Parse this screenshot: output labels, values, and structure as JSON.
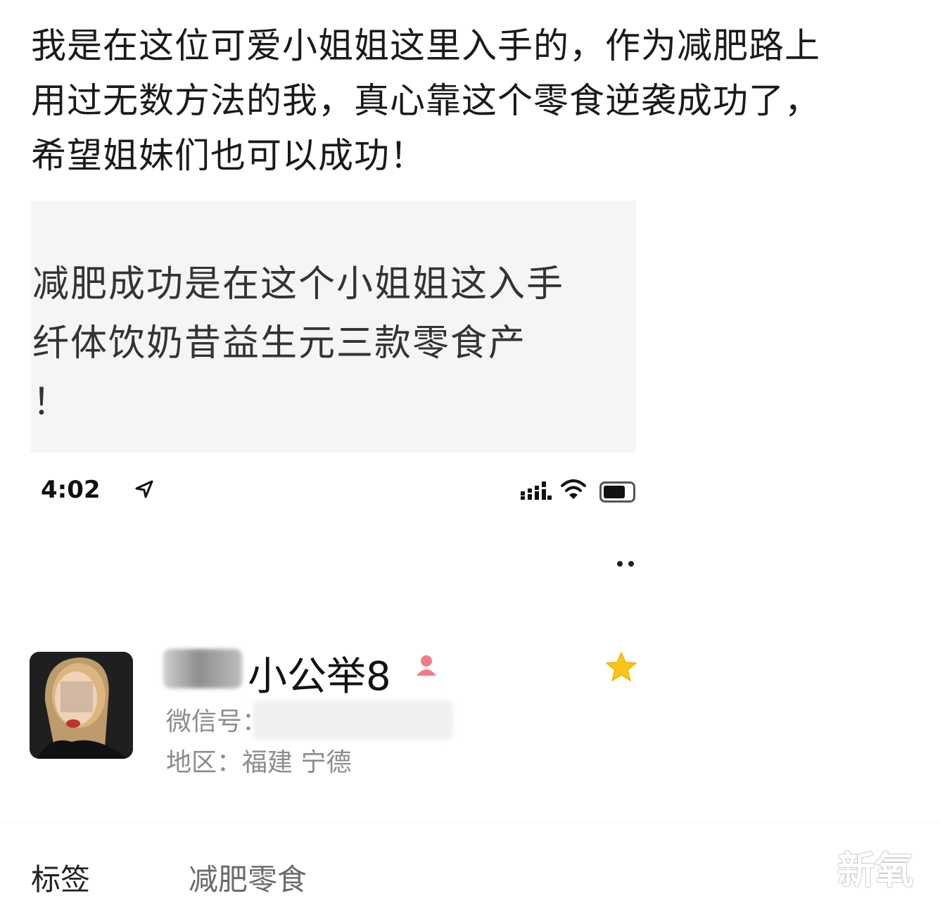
{
  "post": {
    "lines": [
      "我是在这位可爱小姐姐这里入手的，作为减肥路上",
      "用过无数方法的我，真心靠这个零食逆袭成功了，",
      "希望姐妹们也可以成功！"
    ]
  },
  "quote": {
    "lines": [
      "减肥成功是在这个小姐姐这入手",
      "纤体饮奶昔益生元三款零食产",
      "！"
    ]
  },
  "status_bar": {
    "time": "4:02"
  },
  "profile": {
    "nickname": "小公举8",
    "wechat_label": "微信号：",
    "region": "地区：福建 宁德"
  },
  "tags": {
    "label": "标签",
    "value": "减肥零食"
  },
  "watermark": "新氧",
  "colors": {
    "star": "#f8c41a",
    "gender_female": "#f27c86"
  }
}
